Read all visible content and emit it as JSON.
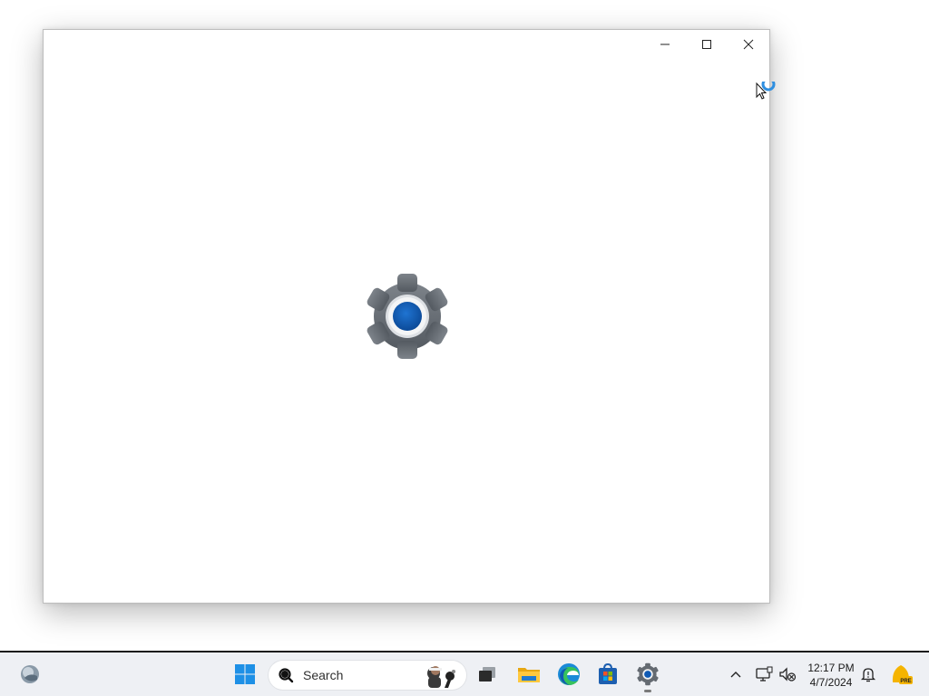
{
  "window": {
    "app": "Settings",
    "splash_icon": "settings-gear-icon",
    "caption_icons": [
      "minimize-icon",
      "maximize-icon",
      "close-icon"
    ]
  },
  "taskbar": {
    "search": {
      "label": "Search",
      "icon": "search-icon",
      "highlight_icon": "search-highlight-icon"
    },
    "pinned_icons": [
      "widgets-icon",
      "start-icon",
      "task-view-icon",
      "file-explorer-icon",
      "edge-icon",
      "store-icon",
      "settings-icon"
    ],
    "tray_icons": [
      "show-hidden-icons-icon",
      "network-icon",
      "volume-muted-icon",
      "notifications-icon",
      "dev-channel-icon"
    ],
    "clock": {
      "time": "12:17 PM",
      "date": "4/7/2024"
    },
    "dev_badge": "PRE"
  },
  "colors": {
    "accent": "#0f5ab4",
    "gear": "#6b7178",
    "taskbar": "#eef0f4"
  }
}
